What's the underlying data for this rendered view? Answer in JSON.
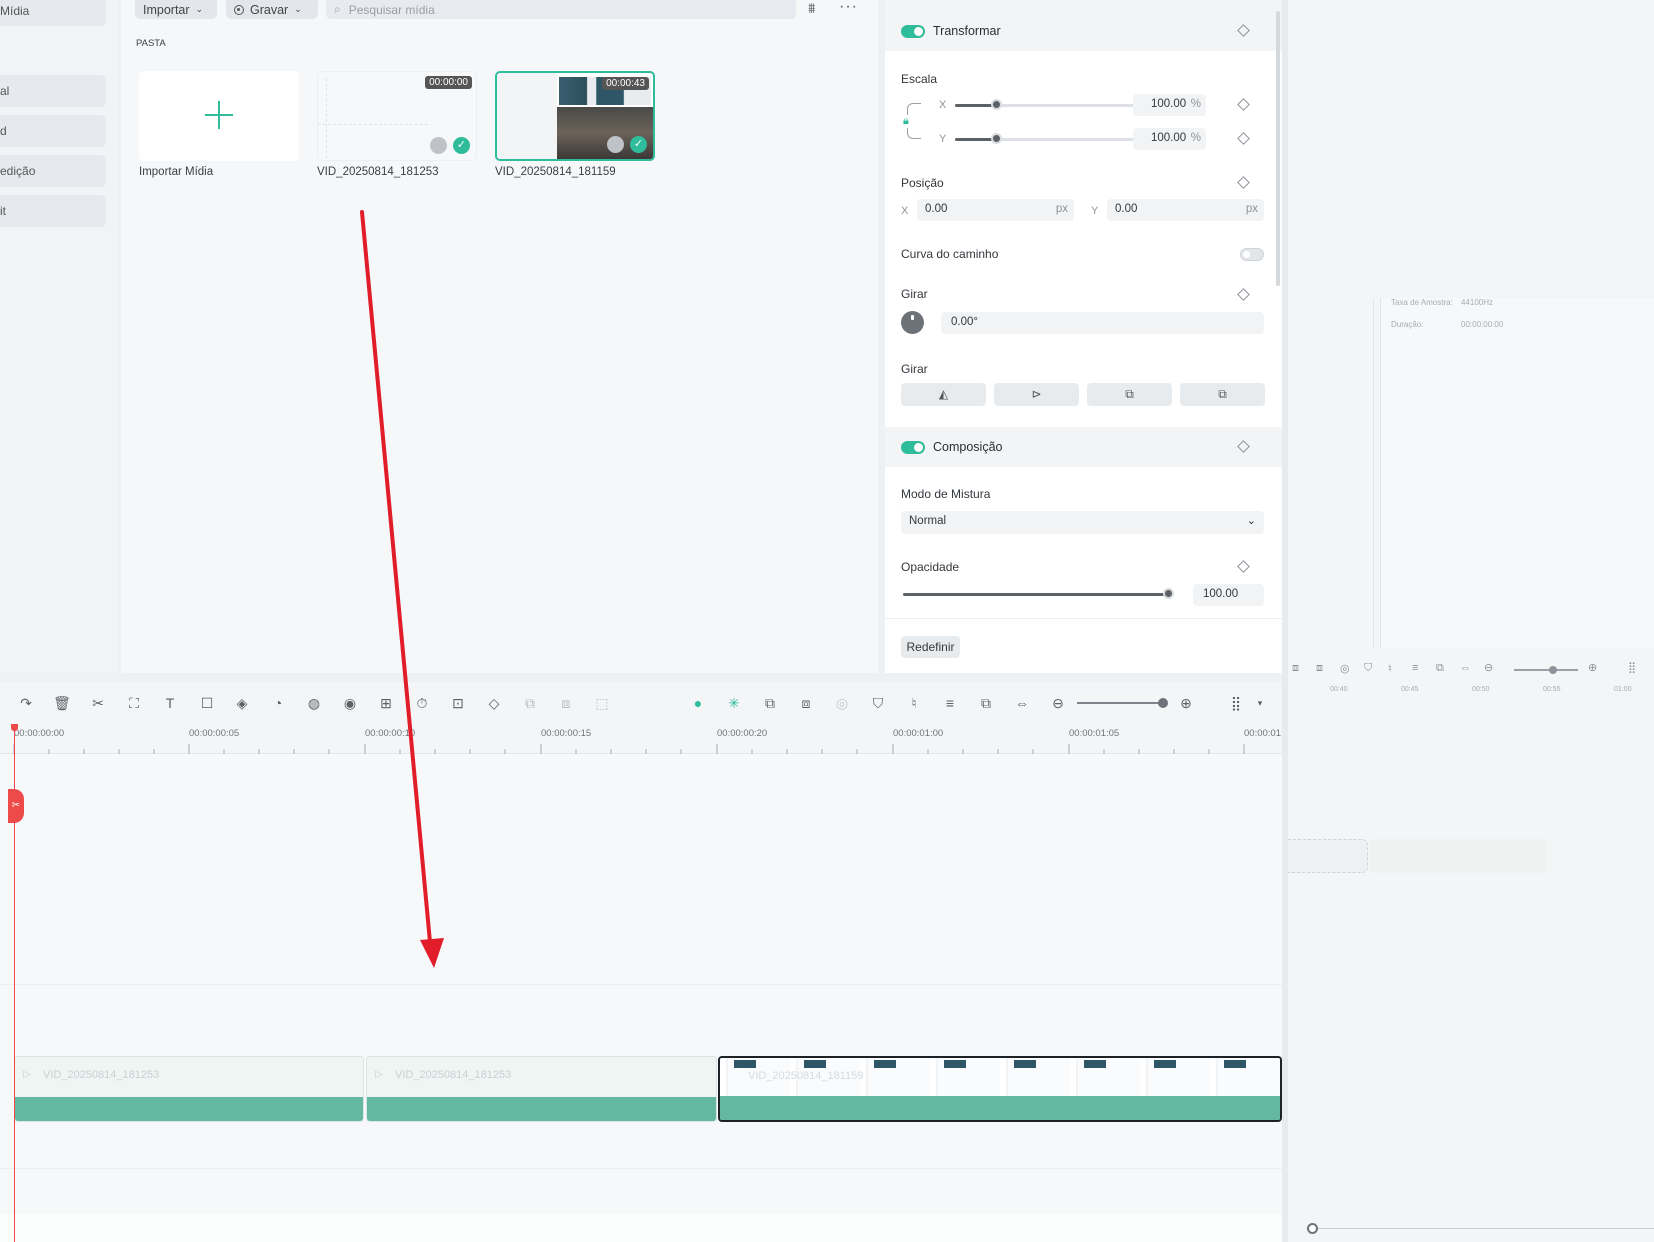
{
  "sidebar": {
    "items": [
      "Mídia",
      "al",
      "d",
      "edição",
      "it"
    ]
  },
  "media": {
    "import_label": "Importar",
    "record_label": "Gravar",
    "search_placeholder": "Pesquisar mídia",
    "folder_label": "PASTA",
    "import_tile_label": "Importar Mídia",
    "files": [
      {
        "name": "VID_20250814_181253",
        "duration": "00:00:00"
      },
      {
        "name": "VID_20250814_181159",
        "duration": "00:00:43"
      }
    ]
  },
  "props": {
    "transform": {
      "title": "Transformar",
      "scale_label": "Escala",
      "x_label": "X",
      "y_label": "Y",
      "scale_x": "100.00",
      "scale_y": "100.00",
      "unit_pct": "%",
      "position_label": "Posição",
      "pos_x": "0.00",
      "pos_y": "0.00",
      "unit_px": "px",
      "path_curve_label": "Curva do caminho",
      "rotate_label": "Girar",
      "rotate_value": "0.00°",
      "flip_label": "Girar"
    },
    "composition": {
      "title": "Composição",
      "blend_label": "Modo de Mistura",
      "blend_value": "Normal",
      "opacity_label": "Opacidade",
      "opacity_value": "100.00"
    },
    "reset_label": "Redefinir"
  },
  "info": {
    "sample_rate_label": "Taxa de Amostra:",
    "sample_rate_value": "44100Hz",
    "duration_label": "Duração:",
    "duration_value": "00:00:00:00"
  },
  "timeline": {
    "ticks": [
      "00:00:00:00",
      "00:00:00:05",
      "00:00:00:10",
      "00:00:00:15",
      "00:00:00:20",
      "00:00:01:00",
      "00:00:01:05",
      "00:00:01"
    ],
    "mini_ticks": [
      "00:40",
      "00:45",
      "00:50",
      "00:55",
      "01:00"
    ],
    "clips": [
      {
        "name": "VID_20250814_181253"
      },
      {
        "name": "VID_20250814_181253"
      },
      {
        "name": "VID_20250814_181159"
      }
    ]
  },
  "colors": {
    "accent": "#2fbc9b",
    "clip_band": "#64b7a0",
    "arrow": "#e11d2a",
    "playhead": "#ef4a4a"
  }
}
